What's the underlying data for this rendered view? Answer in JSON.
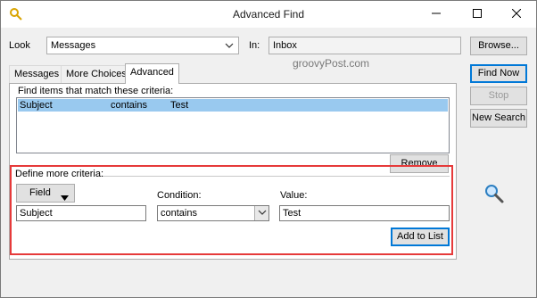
{
  "window": {
    "title": "Advanced Find",
    "icons": [
      "outlook-advanced-find-icon",
      "minimize-icon",
      "maximize-icon",
      "close-icon"
    ]
  },
  "look": {
    "label": "Look",
    "value": "Messages",
    "in_label": "In:",
    "in_value": "Inbox"
  },
  "tabs": [
    {
      "label": "Messages"
    },
    {
      "label": "More Choices"
    },
    {
      "label": "Advanced"
    }
  ],
  "criteria": {
    "heading": "Find items that match these criteria:",
    "rows": [
      {
        "field": "Subject",
        "condition": "contains",
        "value": "Test"
      }
    ],
    "remove_label": "Remove"
  },
  "define": {
    "heading": "Define more criteria:",
    "field_button": "Field",
    "field_value": "Subject",
    "condition_label": "Condition:",
    "condition_value": "contains",
    "value_label": "Value:",
    "value_value": "Test",
    "add_button": "Add to List"
  },
  "buttons": {
    "browse": "Browse...",
    "find_now": "Find Now",
    "stop": "Stop",
    "new_search": "New Search"
  },
  "watermark": "groovyPost.com",
  "colors": {
    "selection": "#99c9ef",
    "highlight_border": "#e63a3a",
    "default_button_border": "#0078d7"
  }
}
